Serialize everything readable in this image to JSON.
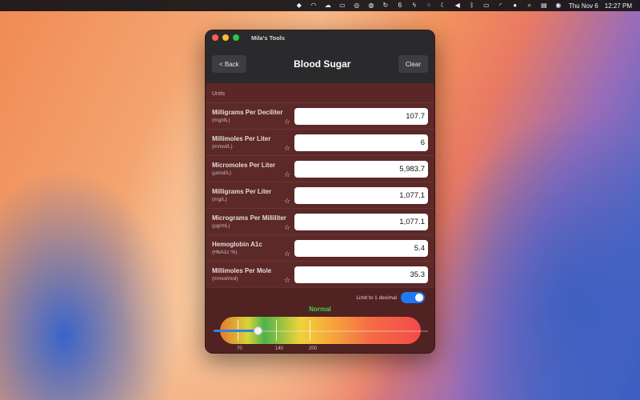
{
  "menubar": {
    "icons": [
      "dropbox-icon",
      "rss-icon",
      "cloud-icon",
      "display-icon",
      "globe-search-icon",
      "vpn-icon",
      "sync-icon",
      "badge-6-icon",
      "bolt-icon",
      "dots-icon",
      "moon-icon",
      "volume-icon",
      "bluetooth-icon",
      "battery-icon",
      "wifi-icon",
      "user-icon",
      "search-icon",
      "control-center-icon",
      "siri-icon"
    ],
    "badge": "6",
    "date": "Thu Nov 6",
    "time": "12:27 PM"
  },
  "window": {
    "title": "Mila's Tools",
    "back_label": "< Back",
    "page_title": "Blood Sugar",
    "clear_label": "Clear",
    "units_label": "Units",
    "rows": [
      {
        "name": "Milligrams Per Deciliter",
        "unit": "(mg/dL)",
        "value": "107.7"
      },
      {
        "name": "Millimoles Per Liter",
        "unit": "(mmol/L)",
        "value": "6"
      },
      {
        "name": "Micromoles Per Liter",
        "unit": "(µmol/L)",
        "value": "5,983.7"
      },
      {
        "name": "Milligrams Per Liter",
        "unit": "(mg/L)",
        "value": "1,077.1"
      },
      {
        "name": "Micrograms Per Milliliter",
        "unit": "(µg/mL)",
        "value": "1,077.1"
      },
      {
        "name": "Hemoglobin A1c",
        "unit": "(HbA1c %)",
        "value": "5.4"
      },
      {
        "name": "Millimoles Per Mole",
        "unit": "(mmol/mol)",
        "value": "35.3"
      }
    ],
    "star_glyph": "☆",
    "limit_label": "Limit to 1 decimal",
    "limit_enabled": true,
    "status": "Normal",
    "status_color": "#3fd24a",
    "gauge_ticks": [
      "70",
      "140",
      "200"
    ],
    "slider_value_fraction": 0.21,
    "accent_color": "#1d7af3"
  }
}
